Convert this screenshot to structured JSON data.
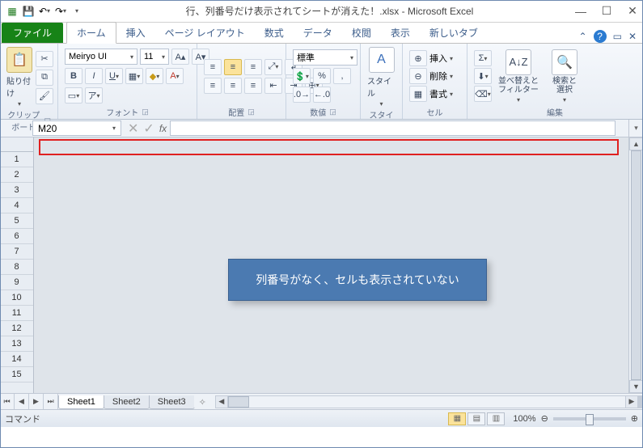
{
  "titlebar": {
    "title": "行、列番号だけ表示されてシートが消えた！.xlsx - Microsoft Excel"
  },
  "tabs": {
    "file": "ファイル",
    "home": "ホーム",
    "insert": "挿入",
    "layout": "ページ レイアウト",
    "formulas": "数式",
    "data": "データ",
    "review": "校閲",
    "view": "表示",
    "newtab": "新しいタブ"
  },
  "ribbon": {
    "clipboard": {
      "label": "クリップボード",
      "paste": "貼り付け"
    },
    "font": {
      "label": "フォント",
      "name": "Meiryo UI",
      "size": "11"
    },
    "align": {
      "label": "配置"
    },
    "number": {
      "label": "数値",
      "format": "標準"
    },
    "styles": {
      "label": "スタイル",
      "btn": "スタイル"
    },
    "cells": {
      "label": "セル",
      "insert": "挿入",
      "delete": "削除",
      "format": "書式"
    },
    "editing": {
      "label": "編集",
      "sort": "並べ替えと\nフィルター",
      "find": "検索と\n選択"
    }
  },
  "formula": {
    "namebox": "M20"
  },
  "callout": "列番号がなく、セルも表示されていない",
  "rows": [
    "1",
    "2",
    "3",
    "4",
    "5",
    "6",
    "7",
    "8",
    "9",
    "10",
    "11",
    "12",
    "13",
    "14",
    "15"
  ],
  "sheets": {
    "s1": "Sheet1",
    "s2": "Sheet2",
    "s3": "Sheet3"
  },
  "status": {
    "mode": "コマンド",
    "zoom": "100%"
  }
}
